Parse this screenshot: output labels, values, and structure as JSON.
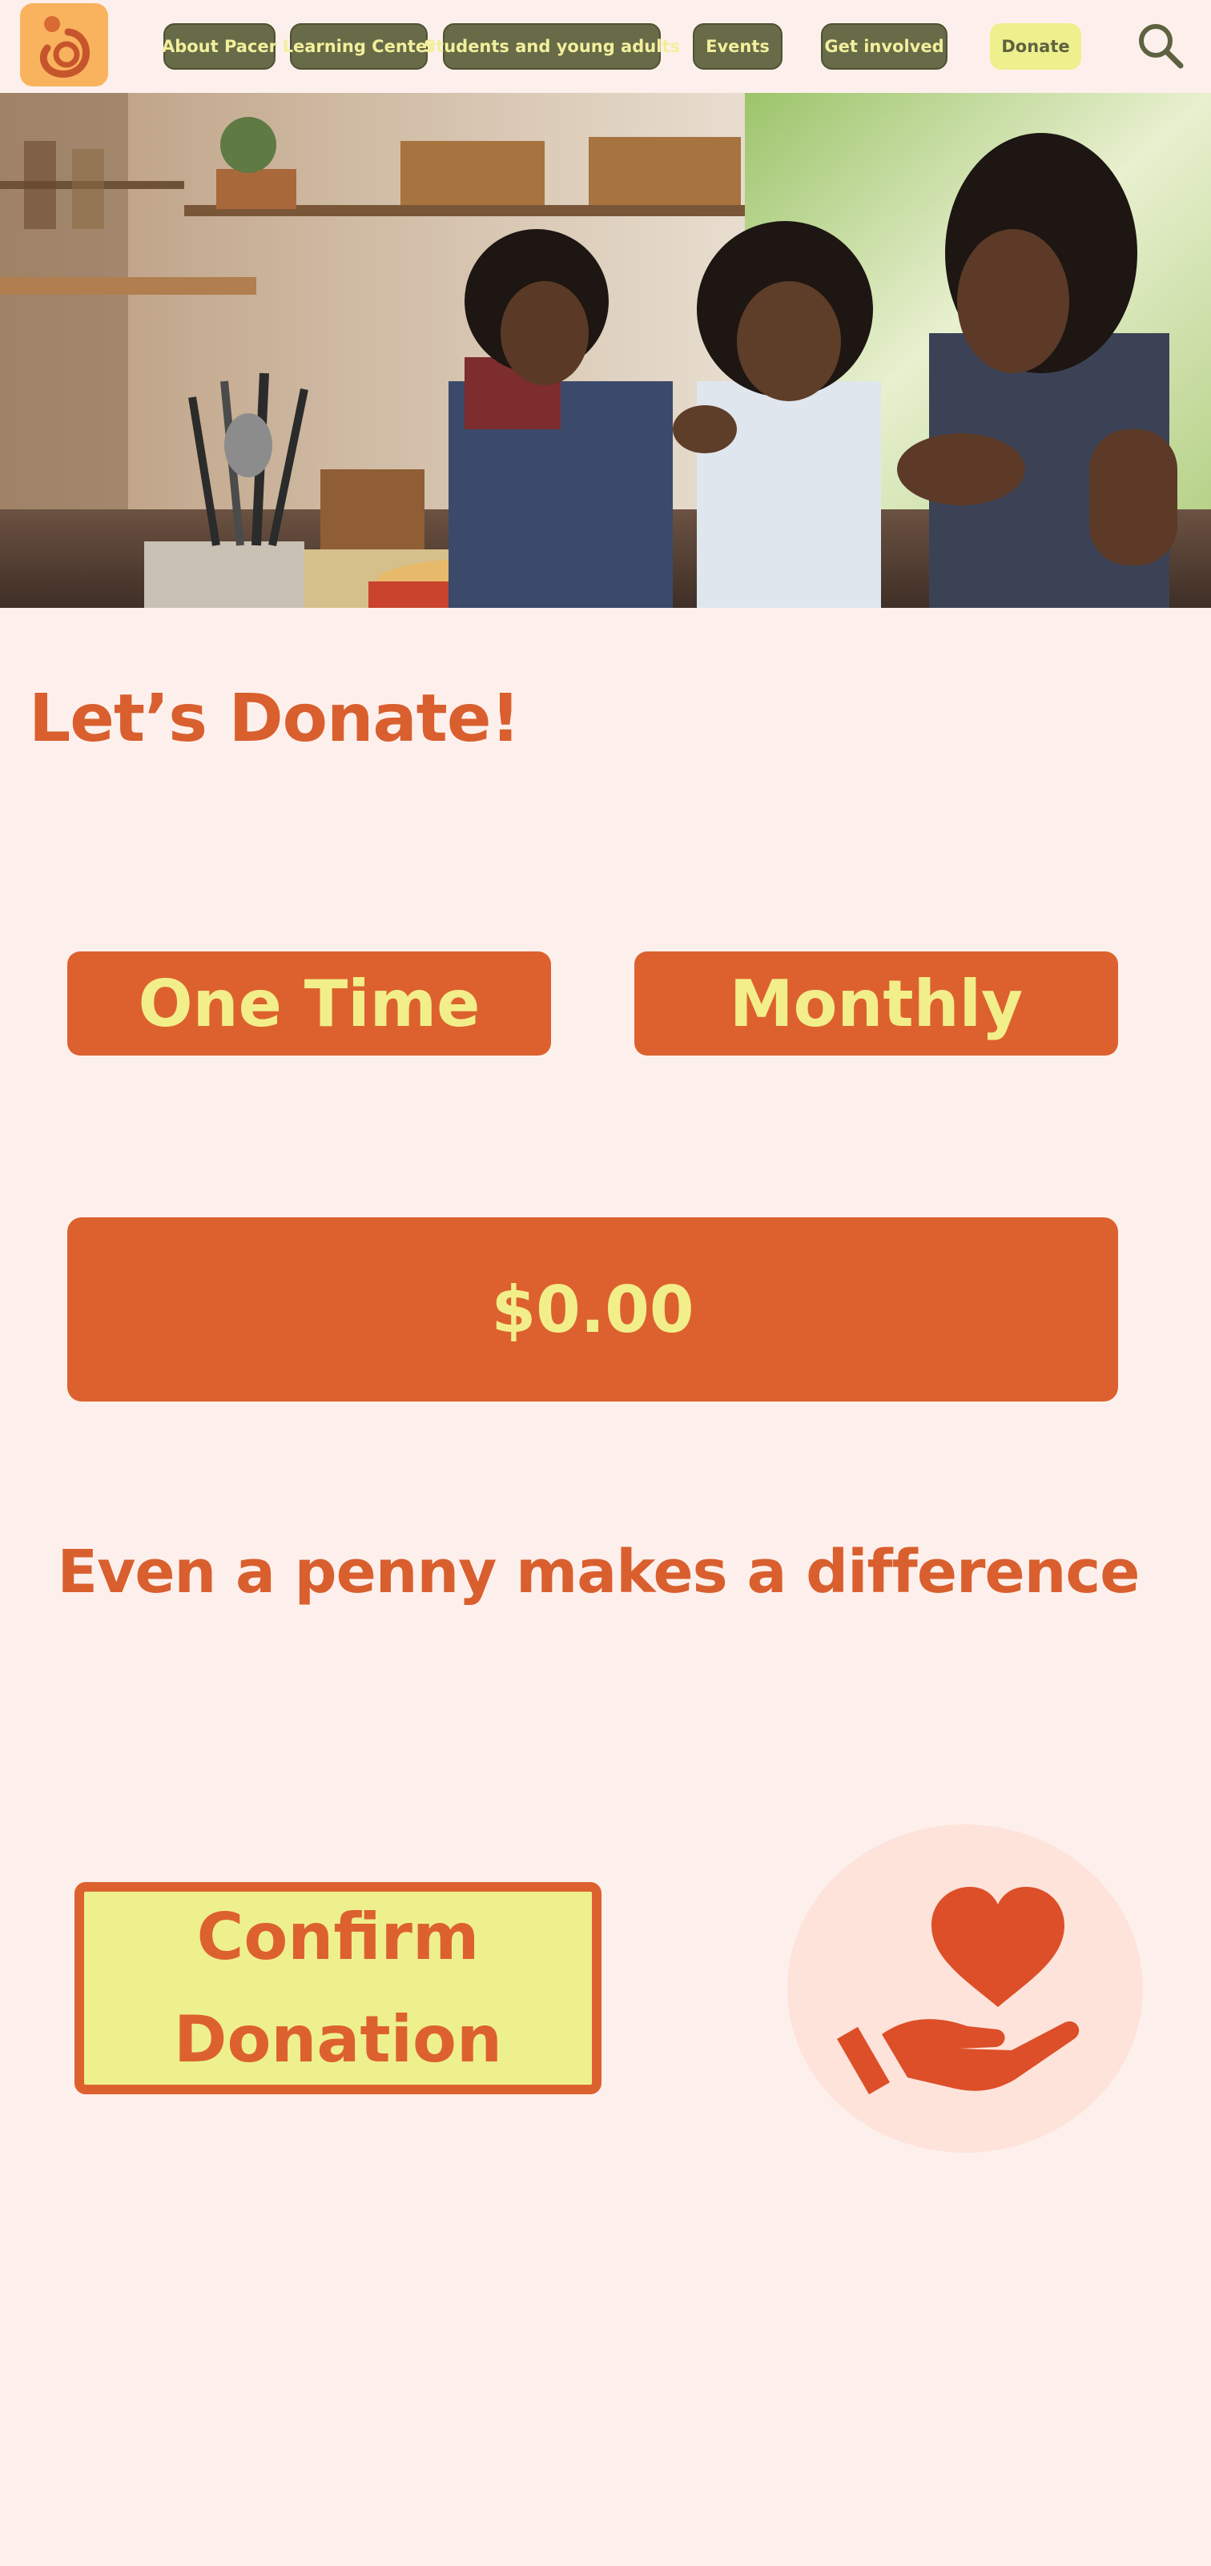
{
  "header": {
    "logo_name": "pacer-logo",
    "nav": [
      {
        "label": "About Pacer"
      },
      {
        "label": "Learning Center"
      },
      {
        "label": "Students and young adults"
      },
      {
        "label": "Events"
      },
      {
        "label": "Get involved"
      },
      {
        "label": "Donate"
      }
    ],
    "search_icon": "search-icon"
  },
  "hero": {
    "image": "family-cooking-photo"
  },
  "main": {
    "title": "Let’s Donate!",
    "frequency_options": [
      {
        "label": "One Time"
      },
      {
        "label": "Monthly"
      }
    ],
    "amount_value": "$0.00",
    "tagline": "Even a penny makes a difference",
    "confirm_button": {
      "line1": "Confirm",
      "line2": "Donation"
    },
    "donation_icon": "heart-in-hand-icon"
  },
  "colors": {
    "background": "#fdf0ec",
    "accent": "#dd612f",
    "nav_green": "#686b48",
    "highlight_yellow": "#eef08e",
    "logo_orange": "#f9b35f"
  }
}
